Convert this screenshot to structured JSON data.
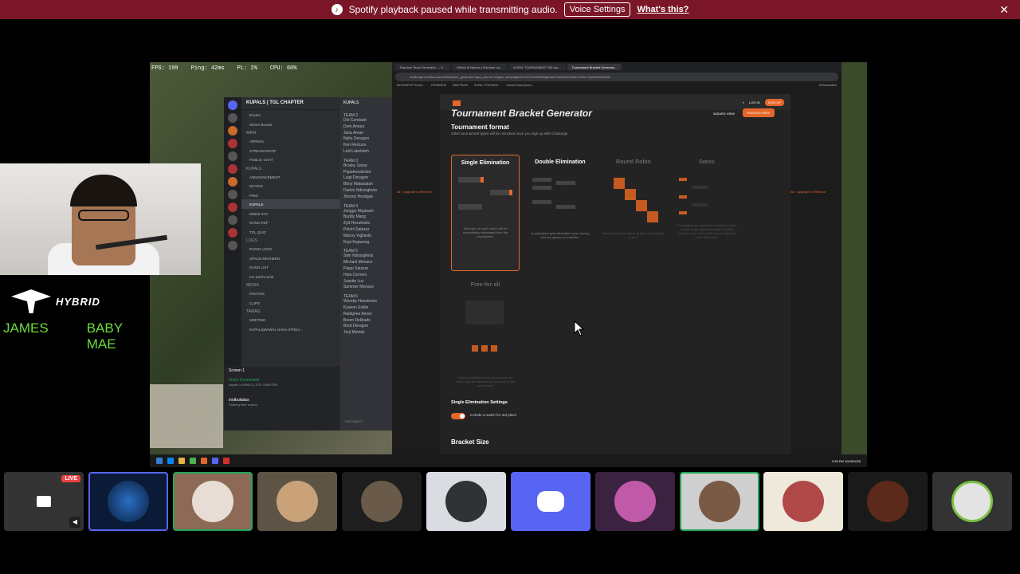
{
  "notice": {
    "icon": "spotify-icon",
    "text": "Spotify playback paused while transmitting audio.",
    "button": "Voice Settings",
    "link": "What's this?",
    "close": "✕"
  },
  "game_hud": {
    "fps": "FPS: 199",
    "ping": "Ping: 42ms",
    "pl": "PL: 2%",
    "cpu": "CPU: 60%"
  },
  "discord": {
    "server": "KUPALS | TGL CHAPTER",
    "events": "Events",
    "boosts": "Server Boosts",
    "categories": [
      {
        "name": "MAIN",
        "channels": [
          "ARRIVAL",
          "STREAM-NOTIF",
          "PUBLIC-CHAT"
        ]
      },
      {
        "name": "KUPALS",
        "channels": [
          "ANNOUNCEMENT",
          "NOTICE",
          "PING",
          "KUPALS",
          "MODS STC",
          "GANG REP",
          "TGL QUIZ"
        ]
      },
      {
        "name": "LOGS",
        "channels": [
          "RADIO LOGS",
          "SPACE-RESHEEN",
          "GANG LIST",
          "mn-mech-remit"
        ]
      },
      {
        "name": "MEDIA",
        "channels": [
          "PHOTOS",
          "CLIPS"
        ]
      },
      {
        "name": "TAWAG",
        "channels": [
          "MEETING",
          "KUPALS|BAWAL NAKA STREA..."
        ]
      }
    ],
    "screen": "Screen 1",
    "voice_connected": "Voice Connected",
    "voice_sub": "kupals / KUPALS | TGL CHAPTER",
    "username": "inotbuladas",
    "user_status": "Sharing their screen",
    "channel_header": "KUPALS",
    "teams": [
      {
        "label": "TEAM 2",
        "members": [
          "Del Combatir",
          "Dom Amaru",
          "Jana Amari",
          "Nahz Deragon",
          "Ken Recluso",
          "Lelil Lakeleteh"
        ]
      },
      {
        "label": "TEAM 3",
        "members": [
          "Brosky Sahur",
          "Papahesukristo",
          "Luigi Deragon",
          "Bboy Makasalan",
          "Darkin Ndrangheta",
          "Jhonny Hooligan"
        ]
      },
      {
        "label": "TEAM 4",
        "members": [
          "Jonggo Maybach",
          "Buddy Mang",
          "Zyd Hesukristo",
          "Potchi Salazar",
          "Macoy Vigilante",
          "Kepi Kepweng"
        ]
      },
      {
        "label": "TEAM 5",
        "members": [
          "Slim Ndrangheta",
          "Michael Menace",
          "Paigo Salazar",
          "Hela Cervero",
          "Juanito Luv",
          "Summer Menace"
        ]
      },
      {
        "label": "TEAM 6",
        "members": [
          "Wemby Hesukristo",
          "Kyanon Evillie",
          "Raldgeee Amari",
          "Boom Delikado",
          "Bord Deragon",
          "Jorji Melody"
        ]
      }
    ],
    "message_placeholder": "Message #"
  },
  "browser": {
    "tabs": [
      "Random Team Generator — S...",
      "Wheel of Names | Random na...",
      "KUPAL TOURNAMENT 25k tou...",
      "Tournament Bracket Generato..."
    ],
    "url": "challonge.com/tournament/bracket_generator?gad_source=1&gad_campaignid=21071418649&gbraid=0AAAAAC4k5c1240m-Oy2bSbGkNAk...",
    "bookmarks": [
      "MOONDROP Sound...",
      "FARMASHE",
      "BAN PRASI",
      "KUPAL TOURNAM...",
      "Normal Class Quest...",
      "All Bookmarks"
    ]
  },
  "challonge": {
    "login": "LOG IN",
    "signup": "SIGN UP",
    "title": "Tournament Bracket Generator",
    "wizard": "WIZARD VIEW",
    "publish": "PUBLISH VIEW",
    "format_heading": "Tournament format",
    "format_sub": "Other tournament types will be unlocked once you sign up with Challonge.",
    "upgrade": "All · Upgrade to Remove",
    "formats": [
      {
        "name": "Single Elimination",
        "desc": "The loser of each match will be immediately eliminated from the tournament."
      },
      {
        "name": "Double Elimination",
        "desc": "A participant gets eliminated upon having lost two games or matches."
      },
      {
        "name": "Round Robin",
        "desc": "Each participant meets all other participants in turn."
      },
      {
        "name": "Swiss",
        "desc": "Participants are paired in rounds that each contain large opponents with a similar winning score, but not the same opponent more than once."
      },
      {
        "name": "Free-for-all",
        "desc": "Several participants are grouped in one match and the winners will advance to the next round."
      }
    ],
    "settings_heading": "Single Elimination Settings",
    "third_place": "Include a match for 3rd place",
    "bracket_size": "Bracket Size"
  },
  "overlay": {
    "brand": "HYBRID",
    "name_left": "JAMES",
    "name_right": "BABY MAE"
  },
  "taskbar": {
    "clock": "2:58 PM",
    "date": "10/25/2025"
  },
  "participants": {
    "live_badge": "LIVE",
    "tiles": [
      "screen-share",
      "gamer-avatar",
      "user-avatar",
      "sunglasses-avatar",
      "user-avatar",
      "squidward-avatar",
      "discord-default-avatar",
      "art-avatar",
      "user-avatar",
      "cartoon-avatar",
      "dark-avatar",
      "globe-avatar"
    ]
  },
  "colors": {
    "notice_bg": "#7a1628",
    "discord_blurple": "#5865f2",
    "challonge_orange": "#e5672a",
    "name_green": "#6bdc3f",
    "speaking_green": "#23a55a"
  }
}
